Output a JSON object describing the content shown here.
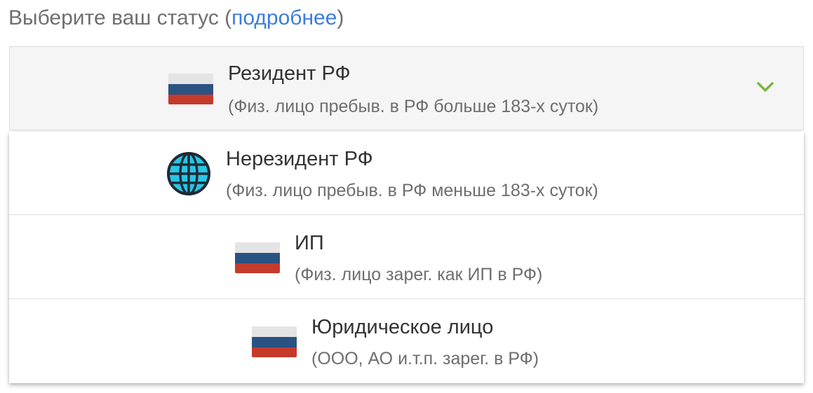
{
  "heading": {
    "prefix": "Выберите ваш статус (",
    "link": "подробнее",
    "suffix": ")"
  },
  "selected": {
    "title": "Резидент РФ",
    "subtitle": "(Физ. лицо пребыв. в РФ больше 183-х суток)",
    "icon": "russia-flag-icon"
  },
  "options": [
    {
      "title": "Нерезидент РФ",
      "subtitle": "(Физ. лицо пребыв. в РФ меньше 183-х суток)",
      "icon": "globe-icon"
    },
    {
      "title": "ИП",
      "subtitle": "(Физ. лицо зарег. как ИП в РФ)",
      "icon": "russia-flag-icon"
    },
    {
      "title": "Юридическое лицо",
      "subtitle": "(ООО, АО и.т.п. зарег. в РФ)",
      "icon": "russia-flag-icon"
    }
  ],
  "colors": {
    "link": "#3b7ddd",
    "chevron": "#7cb342",
    "globe": "#29c5e6"
  }
}
